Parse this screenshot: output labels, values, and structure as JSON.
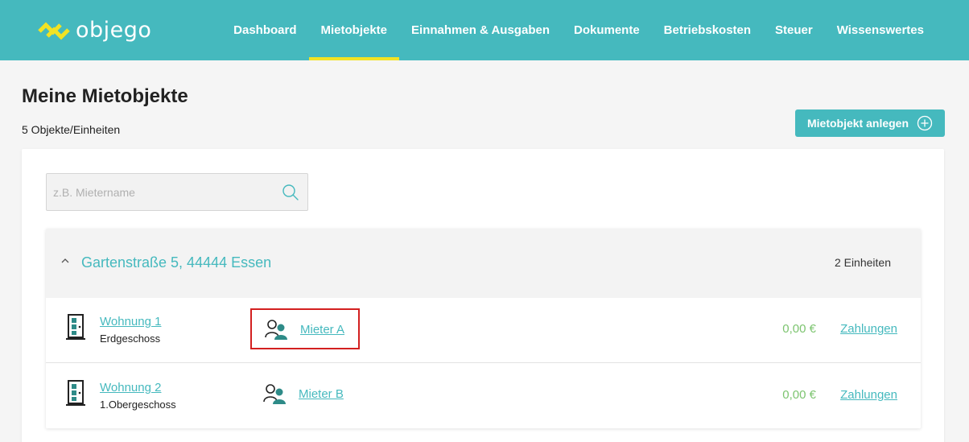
{
  "app": {
    "logo_text": "objego",
    "colors": {
      "brand": "#45b9be",
      "accent_yellow": "#f2e323",
      "amount_green": "#7cc46f",
      "highlight_red": "#d32020"
    }
  },
  "nav": {
    "items": [
      {
        "label": "Dashboard",
        "active": false
      },
      {
        "label": "Mietobjekte",
        "active": true
      },
      {
        "label": "Einnahmen & Ausgaben",
        "active": false
      },
      {
        "label": "Dokumente",
        "active": false
      },
      {
        "label": "Betriebskosten",
        "active": false
      },
      {
        "label": "Steuer",
        "active": false
      },
      {
        "label": "Wissenswertes",
        "active": false
      }
    ]
  },
  "page": {
    "title": "Meine Mietobjekte",
    "subtitle": "5 Objekte/Einheiten",
    "create_button": {
      "label": "Mietobjekt anlegen",
      "icon": "plus-circle-icon"
    }
  },
  "search": {
    "placeholder": "z.B. Mietername",
    "value": "",
    "icon": "search-icon"
  },
  "property": {
    "address": "Gartenstraße 5, 44444 Essen",
    "units_count": "2 Einheiten",
    "expanded": true,
    "units": [
      {
        "name": "Wohnung 1",
        "floor": "Erdgeschoss",
        "tenant": "Mieter A",
        "amount": "0,00 €",
        "payments_label": "Zahlungen",
        "highlighted": true
      },
      {
        "name": "Wohnung 2",
        "floor": "1.Obergeschoss",
        "tenant": "Mieter B",
        "amount": "0,00 €",
        "payments_label": "Zahlungen",
        "highlighted": false
      }
    ]
  }
}
